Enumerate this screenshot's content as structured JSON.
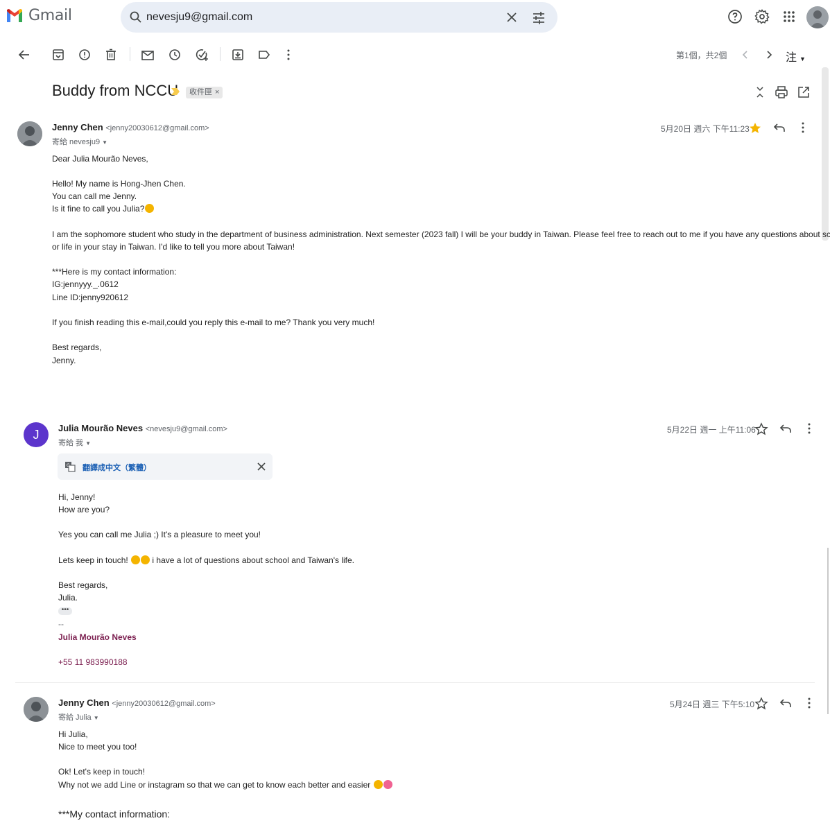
{
  "app": {
    "name": "Gmail"
  },
  "search": {
    "value": "nevesju9@gmail.com"
  },
  "toolbar": {
    "pager": "第1個，共2個",
    "input_lang": "注"
  },
  "thread": {
    "subject": "Buddy from NCCU",
    "label": "收件匣"
  },
  "messages": [
    {
      "sender_name": "Jenny Chen",
      "sender_email": "<jenny20030612@gmail.com>",
      "to": "寄給 nevesju9",
      "date": "5月20日 週六 下午11:23",
      "starred": true,
      "body": [
        "Dear Julia Mourão Neves,",
        "Hello! My name is Hong-Jhen Chen.",
        "You can call me Jenny.",
        "Is it fine to call you Julia?",
        "I am the sophomore student who study in the department of business administration. Next semester (2023 fall) I will be your buddy in Taiwan. Please feel free to reach out to me if you have any questions about school",
        "or life in your stay in Taiwan. I'd like to tell you more   about Taiwan!",
        "***Here is my contact information:",
        "IG:jennyyy._.0612",
        "Line ID:jenny920612",
        "If you finish reading this e-mail,could you reply this e-mail to me? Thank you very much!",
        "Best regards,",
        "Jenny."
      ]
    },
    {
      "sender_name": "Julia Mourão Neves",
      "sender_initial": "J",
      "sender_email": "<nevesju9@gmail.com>",
      "to": "寄給 我",
      "date": "5月22日 週一 上午11:06",
      "starred": false,
      "translate_label": "翻譯成中文（繁體）",
      "body": [
        "Hi, Jenny!",
        "How are you?",
        "Yes you can call me Julia ;) It's a pleasure to meet you!",
        "Lets keep in touch!",
        "i have a lot of questions about school and Taiwan's life.",
        "Best regards,",
        "Julia."
      ],
      "signature_dash": "--",
      "signature_name": "Julia Mourão Neves",
      "signature_phone": "+55 11 983990188"
    },
    {
      "sender_name": "Jenny Chen",
      "sender_email": "<jenny20030612@gmail.com>",
      "to": "寄給 Julia",
      "date": "5月24日 週三 下午5:10",
      "starred": false,
      "body": [
        "Hi Julia,",
        "Nice to meet you too!",
        "Ok! Let's keep in touch!",
        "Why not we add Line or instagram so that we can get to know each better and easier",
        "***My contact information:"
      ]
    }
  ],
  "colors": {
    "accent": "#0b57d0",
    "star": "#f4b400",
    "avatar_j": "#5c35cc",
    "signature": "#7b1e4f"
  }
}
